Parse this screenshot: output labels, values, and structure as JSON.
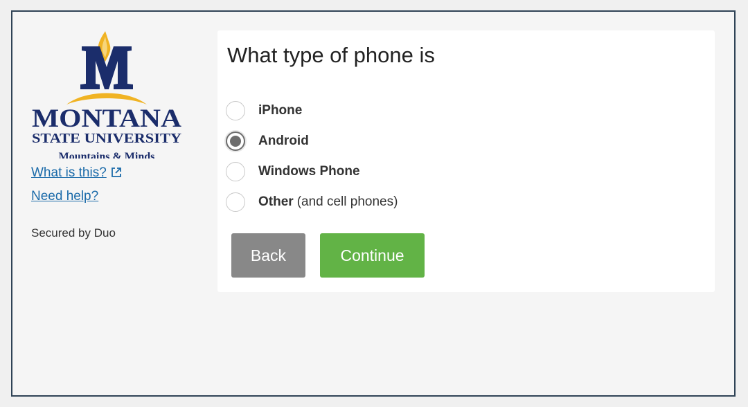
{
  "sidebar": {
    "logo": {
      "icon": "msu-logo",
      "letter": "M",
      "name": "MONTANA",
      "subtitle": "STATE UNIVERSITY",
      "tagline": "Mountains & Minds",
      "colors": {
        "navy": "#1b2d6b",
        "gold": "#f0b323"
      }
    },
    "what_is_this_label": "What is this?",
    "need_help_label": "Need help?",
    "secured_by": "Secured by Duo"
  },
  "form": {
    "question": "What type of phone is",
    "options": [
      {
        "label": "iPhone",
        "sub": "",
        "checked": false
      },
      {
        "label": "Android",
        "sub": "",
        "checked": true
      },
      {
        "label": "Windows Phone",
        "sub": "",
        "checked": false
      },
      {
        "label": "Other",
        "sub": "(and cell phones)",
        "checked": false
      }
    ],
    "selected": "Android"
  },
  "buttons": {
    "back_label": "Back",
    "continue_label": "Continue"
  },
  "colors": {
    "frame_border": "#2f4356",
    "link": "#1a6aa9",
    "back_button": "#888888",
    "continue_button": "#62b346"
  }
}
